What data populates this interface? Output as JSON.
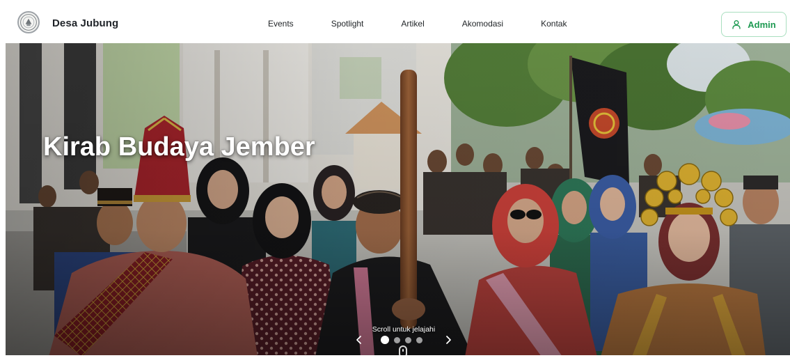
{
  "brand": {
    "name": "Desa Jubung",
    "logo_icon": "village-seal-logo"
  },
  "nav": {
    "items": [
      {
        "label": "Events"
      },
      {
        "label": "Spotlight"
      },
      {
        "label": "Artikel"
      },
      {
        "label": "Akomodasi"
      },
      {
        "label": "Kontak"
      }
    ]
  },
  "admin_button": {
    "label": "Admin",
    "icon": "user-icon"
  },
  "hero": {
    "title": "Kirab Budaya Jember",
    "scroll_hint": "Scroll untuk jelajahi",
    "carousel": {
      "slide_count": 4,
      "active_index": 0,
      "prev_icon": "chevron-left-icon",
      "next_icon": "chevron-right-icon",
      "scroll_icon": "mouse-scroll-icon"
    }
  },
  "colors": {
    "accent": "#1e9a52",
    "accent_border": "#a9dfbf",
    "nav_text": "#222629",
    "brand_text": "#1f2328",
    "hero_text": "#ffffff"
  }
}
